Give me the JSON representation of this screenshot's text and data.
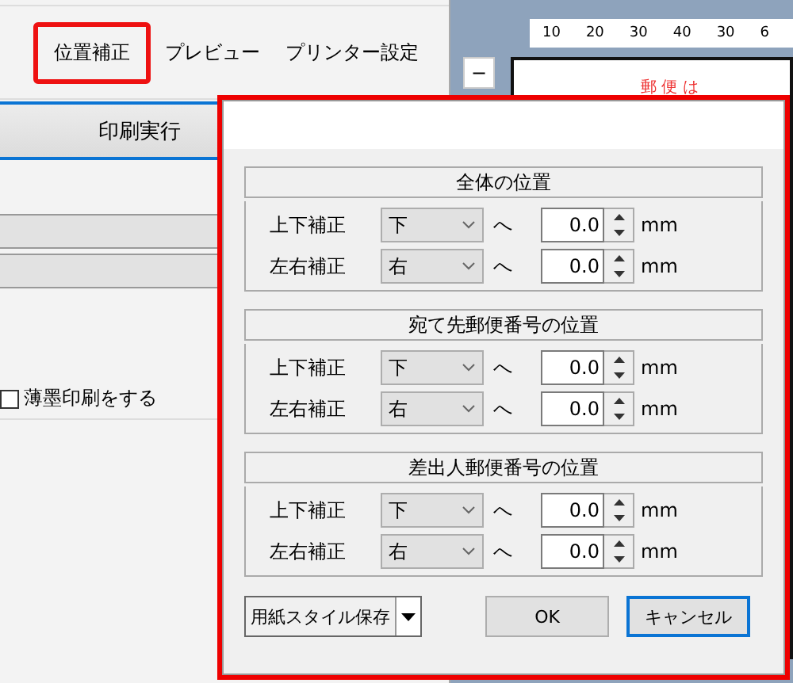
{
  "toolbar": {
    "items": [
      {
        "label": "位置補正",
        "selected": true
      },
      {
        "label": "プレビュー",
        "selected": false
      },
      {
        "label": "プリンター設定",
        "selected": false
      }
    ]
  },
  "print_button": "印刷実行",
  "faint_print": {
    "label": "薄墨印刷をする",
    "checked": false
  },
  "preview": {
    "ruler": [
      "10",
      "20",
      "30",
      "40",
      "30",
      "6"
    ],
    "zoom_button": "−",
    "postcard_text": "郵 便 は"
  },
  "dialog": {
    "groups": [
      {
        "title": "全体の位置",
        "rows": [
          {
            "label": "上下補正",
            "direction": "下",
            "arrow": "へ",
            "value": "0.0",
            "unit": "mm"
          },
          {
            "label": "左右補正",
            "direction": "右",
            "arrow": "へ",
            "value": "0.0",
            "unit": "mm"
          }
        ]
      },
      {
        "title": "宛て先郵便番号の位置",
        "rows": [
          {
            "label": "上下補正",
            "direction": "下",
            "arrow": "へ",
            "value": "0.0",
            "unit": "mm"
          },
          {
            "label": "左右補正",
            "direction": "右",
            "arrow": "へ",
            "value": "0.0",
            "unit": "mm"
          }
        ]
      },
      {
        "title": "差出人郵便番号の位置",
        "rows": [
          {
            "label": "上下補正",
            "direction": "下",
            "arrow": "へ",
            "value": "0.0",
            "unit": "mm"
          },
          {
            "label": "左右補正",
            "direction": "右",
            "arrow": "へ",
            "value": "0.0",
            "unit": "mm"
          }
        ]
      }
    ],
    "save_style": "用紙スタイル保存",
    "buttons": [
      {
        "label": "OK",
        "default": false
      },
      {
        "label": "キャンセル",
        "default": true
      }
    ]
  }
}
